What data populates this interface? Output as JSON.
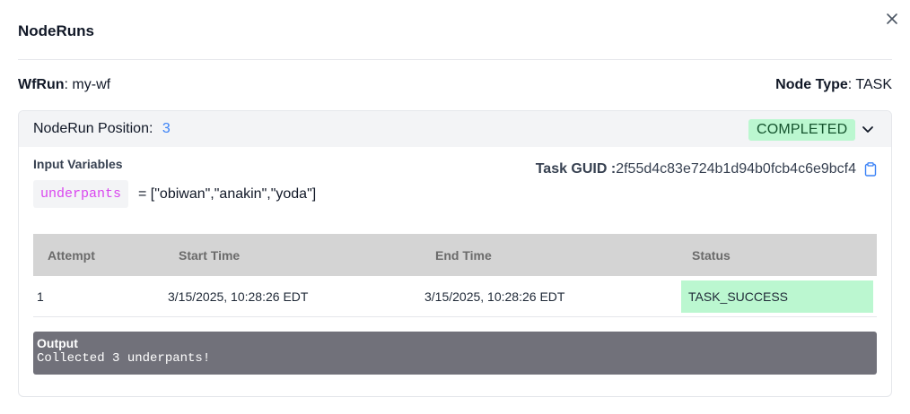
{
  "dialog": {
    "title": "NodeRuns",
    "close_icon": "close-icon"
  },
  "meta": {
    "wfrun_label": "WfRun",
    "wfrun_value": "my-wf",
    "node_type_label": "Node Type",
    "node_type_value": "TASK"
  },
  "noderun": {
    "position_label": "NodeRun Position:",
    "position_value": "3",
    "status": "COMPLETED",
    "expand_icon": "chevron-down-icon",
    "input_variables_label": "Input Variables",
    "variables": [
      {
        "name": "underpants",
        "value": "= [\"obiwan\",\"anakin\",\"yoda\"]"
      }
    ],
    "task_guid_label": "Task GUID :",
    "task_guid_value": "2f55d4c83e724b1d94b0fcb4c6e9bcf4",
    "copy_icon": "clipboard-icon"
  },
  "attempts_table": {
    "columns": [
      "Attempt",
      "Start Time",
      "End Time",
      "Status"
    ],
    "rows": [
      {
        "attempt": "1",
        "start_time": "3/15/2025, 10:28:26 EDT",
        "end_time": "3/15/2025, 10:28:26 EDT",
        "status": "TASK_SUCCESS"
      }
    ]
  },
  "output": {
    "label": "Output",
    "text": "Collected 3 underpants!"
  },
  "colors": {
    "accent_blue": "#3b82f6",
    "success_green": "#bbf7d0",
    "variable_magenta": "#d946ef",
    "output_bg": "#71717a"
  }
}
